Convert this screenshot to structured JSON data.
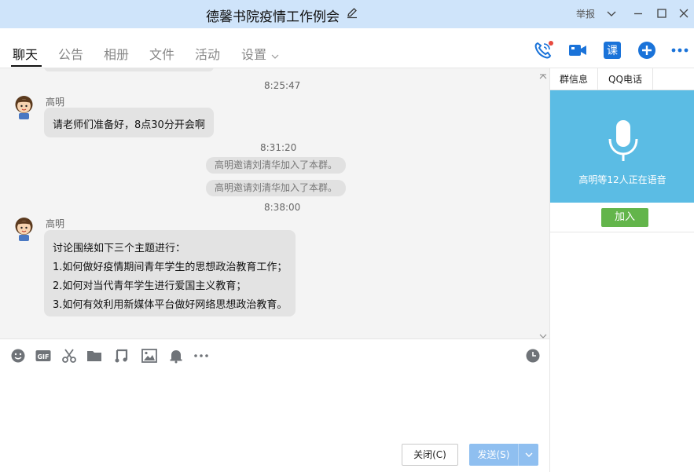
{
  "window": {
    "title": "德馨书院疫情工作例会",
    "report_label": "举报"
  },
  "tabs": [
    {
      "label": "聊天",
      "active": true
    },
    {
      "label": "公告"
    },
    {
      "label": "相册"
    },
    {
      "label": "文件"
    },
    {
      "label": "活动"
    },
    {
      "label": "设置"
    }
  ],
  "toolbar_icons": [
    "voice-call-icon",
    "video-call-icon",
    "class-icon",
    "add-app-icon",
    "more-icon"
  ],
  "toolbar": {
    "class_label": "课"
  },
  "chat": {
    "messages": [
      {
        "type": "time",
        "text": "8:25:47"
      },
      {
        "type": "message",
        "sender": "高明",
        "lines": [
          "请老师们准备好，8点30分开会啊"
        ]
      },
      {
        "type": "time",
        "text": "8:31:20"
      },
      {
        "type": "system",
        "text": "高明邀请刘清华加入了本群。"
      },
      {
        "type": "system",
        "text": "高明邀请刘清华加入了本群。"
      },
      {
        "type": "time",
        "text": "8:38:00"
      },
      {
        "type": "message",
        "sender": "高明",
        "lines": [
          "讨论围绕如下三个主题进行：",
          "1.如何做好疫情期间青年学生的思想政治教育工作；",
          "2.如何对当代青年学生进行爱国主义教育；",
          "3.如何有效利用新媒体平台做好网络思想政治教育。"
        ]
      }
    ]
  },
  "input_tools": [
    "emoji-icon",
    "gif-icon",
    "screenshot-scissors-icon",
    "folder-icon",
    "music-note-icon",
    "image-icon",
    "bell-icon",
    "more-dots-icon",
    "history-clock-icon"
  ],
  "input": {
    "gif_label": "GIF",
    "close_button": "关闭(C)",
    "send_button": "发送(S)"
  },
  "right_panel": {
    "tabs": [
      "群信息",
      "QQ电话"
    ],
    "voice_status": "高明等12人正在语音",
    "join_button": "加入"
  },
  "colors": {
    "titlebar": "#cfe4fa",
    "accent_blue": "#1a73d9",
    "voice_panel": "#5bbce4",
    "join_green": "#63b54b",
    "send_button": "#8fbff0",
    "bubble": "#e3e3e3"
  }
}
